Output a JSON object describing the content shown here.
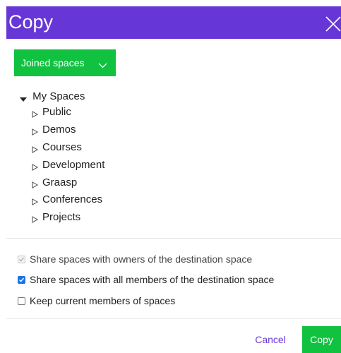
{
  "dialog": {
    "title": "Copy",
    "close_icon": "close-icon",
    "accent_color": "#6736d6",
    "button_color": "#11c140"
  },
  "dropdown": {
    "label": "Joined spaces",
    "icon": "chevron-down-icon"
  },
  "tree": {
    "root": {
      "label": "My Spaces",
      "expanded": true
    },
    "children": [
      {
        "label": "Public"
      },
      {
        "label": "Demos"
      },
      {
        "label": "Courses"
      },
      {
        "label": "Development"
      },
      {
        "label": "Graasp"
      },
      {
        "label": "Conferences"
      },
      {
        "label": "Projects"
      }
    ]
  },
  "options": [
    {
      "label": "Share spaces with owners of the destination space",
      "checked": true,
      "disabled": true
    },
    {
      "label": "Share spaces with all members of the destination space",
      "checked": true,
      "disabled": false
    },
    {
      "label": "Keep current members of spaces",
      "checked": false,
      "disabled": false
    }
  ],
  "footer": {
    "cancel_label": "Cancel",
    "copy_label": "Copy"
  }
}
